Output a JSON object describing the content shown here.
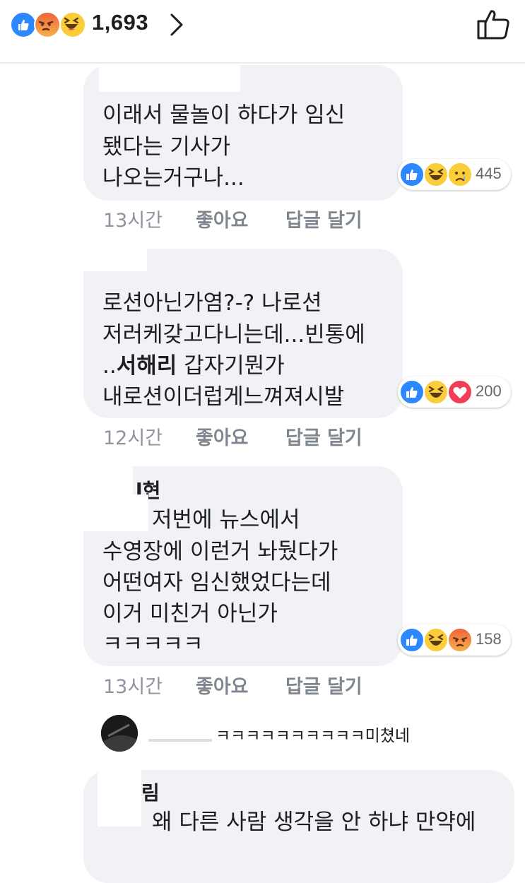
{
  "header": {
    "reaction_count": "1,693",
    "reactions": [
      "like-icon",
      "angry-icon",
      "haha-icon"
    ]
  },
  "comments": [
    {
      "name_fragment": "",
      "lines": [
        "이래서 물놀이 하다가 임신",
        "됐다는 기사가",
        "나오는거구나..."
      ],
      "time": "13시간",
      "like_label": "좋아요",
      "reply_label": "답글 달기",
      "reactions": [
        "like-icon",
        "haha-icon",
        "sad-icon"
      ],
      "reaction_count": "445"
    },
    {
      "name_fragment": "",
      "lines": [
        "로션아닌가염?-? 나로션",
        "저러케갖고다니는데...빈통에",
        "..",
        "내로션이더럽게느껴져시발"
      ],
      "mention": "서해리",
      "line3_rest": " 갑자기뭔가",
      "time": "12시간",
      "like_label": "좋아요",
      "reply_label": "답글 달기",
      "reactions": [
        "like-icon",
        "haha-icon",
        "love-icon"
      ],
      "reaction_count": "200"
    },
    {
      "name_fragment": "l현",
      "lines": [
        "저번에 뉴스에서",
        "수영장에 이런거 놔뒀다가",
        "어떤여자 임신했었다는데",
        "이거 미친거 아닌가",
        "ㅋㅋㅋㅋㅋ"
      ],
      "time": "13시간",
      "like_label": "좋아요",
      "reply_label": "답글 달기",
      "reactions": [
        "like-icon",
        "haha-icon",
        "angry-icon"
      ],
      "reaction_count": "158"
    }
  ],
  "reply_preview": {
    "text": "ㅋㅋㅋㅋㅋㅋㅋㅋㅋㅋ미쳤네"
  },
  "last_comment": {
    "name_fragment": "림",
    "text": "왜 다른 사람 생각을 안 하냐 만약에"
  }
}
